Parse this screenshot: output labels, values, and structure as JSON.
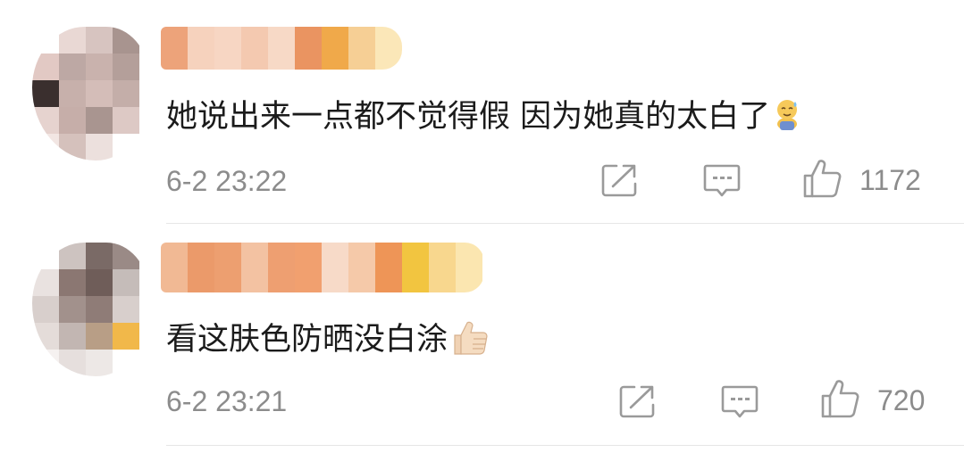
{
  "comments": [
    {
      "text": "她说出来一点都不觉得假 因为她真的太白了",
      "inline_emoji": "sweat-smile-emoji",
      "timestamp": "6-2 23:22",
      "likes": "1172",
      "icons": {
        "share": "share-icon",
        "reply": "comment-icon",
        "like": "thumbs-up-icon"
      }
    },
    {
      "text": "看这肤色防晒没白涂",
      "inline_emoji": "thumbs-up-emoji",
      "timestamp": "6-2 23:21",
      "likes": "720",
      "icons": {
        "share": "share-icon",
        "reply": "comment-icon",
        "like": "thumbs-up-icon"
      }
    }
  ],
  "colors": {
    "text": "#1b1b1b",
    "meta": "#8c8c8c",
    "divider": "#e6e6e6",
    "icon": "#9a9a9a"
  }
}
